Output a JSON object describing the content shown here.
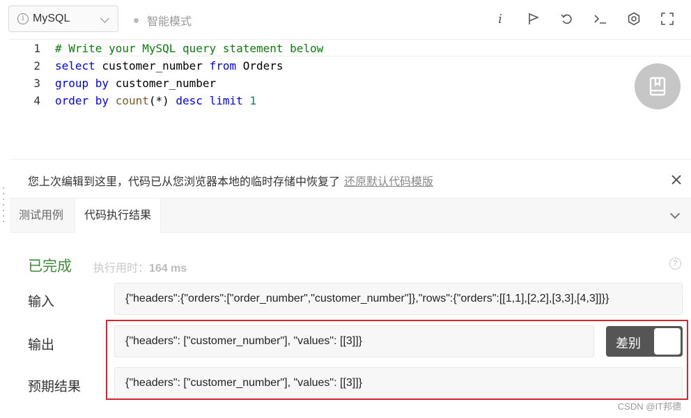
{
  "toolbar": {
    "language": "MySQL",
    "mode_label": "智能模式",
    "icons": [
      "info-icon",
      "flag-icon",
      "reset-icon",
      "terminal-icon",
      "settings-icon",
      "fullscreen-icon"
    ],
    "info_glyph": "i"
  },
  "editor": {
    "lines": [
      {
        "no": "1",
        "tokens": [
          {
            "t": "# Write your MySQL query statement below",
            "c": "cm"
          }
        ]
      },
      {
        "no": "2",
        "tokens": [
          {
            "t": "select",
            "c": "kw"
          },
          {
            "t": " customer_number ",
            "c": ""
          },
          {
            "t": "from",
            "c": "kw"
          },
          {
            "t": " Orders",
            "c": ""
          }
        ]
      },
      {
        "no": "3",
        "tokens": [
          {
            "t": "group by",
            "c": "kw"
          },
          {
            "t": " customer_number",
            "c": ""
          }
        ]
      },
      {
        "no": "4",
        "tokens": [
          {
            "t": "order by",
            "c": "kw"
          },
          {
            "t": " ",
            "c": ""
          },
          {
            "t": "count",
            "c": "fn"
          },
          {
            "t": "(*) ",
            "c": ""
          },
          {
            "t": "desc",
            "c": "kw"
          },
          {
            "t": " ",
            "c": ""
          },
          {
            "t": "limit",
            "c": "kw"
          },
          {
            "t": " ",
            "c": ""
          },
          {
            "t": "1",
            "c": "num"
          }
        ]
      }
    ]
  },
  "notice": {
    "text": "您上次编辑到这里，代码已从您浏览器本地的临时存储中恢复了",
    "link": "还原默认代码模版"
  },
  "tabs": [
    {
      "label": "测试用例",
      "active": false
    },
    {
      "label": "代码执行结果",
      "active": true
    }
  ],
  "result": {
    "status": "已完成",
    "exec_time_label": "执行用时：",
    "exec_time_value": "164 ms",
    "input_label": "输入",
    "input_value": "{\"headers\":{\"orders\":[\"order_number\",\"customer_number\"]},\"rows\":{\"orders\":[[1,1],[2,2],[3,3],[4,3]]}}",
    "output_label": "输出",
    "output_value": "{\"headers\": [\"customer_number\"], \"values\": [[3]]}",
    "expected_label": "预期结果",
    "expected_value": "{\"headers\": [\"customer_number\"], \"values\": [[3]]}",
    "diff_label": "差别"
  },
  "watermark": "CSDN @IT邦德",
  "colors": {
    "success": "#3f8d35",
    "highlight_frame": "#d9232e",
    "keyword": "#0000ff",
    "comment": "#0b7d0b"
  }
}
